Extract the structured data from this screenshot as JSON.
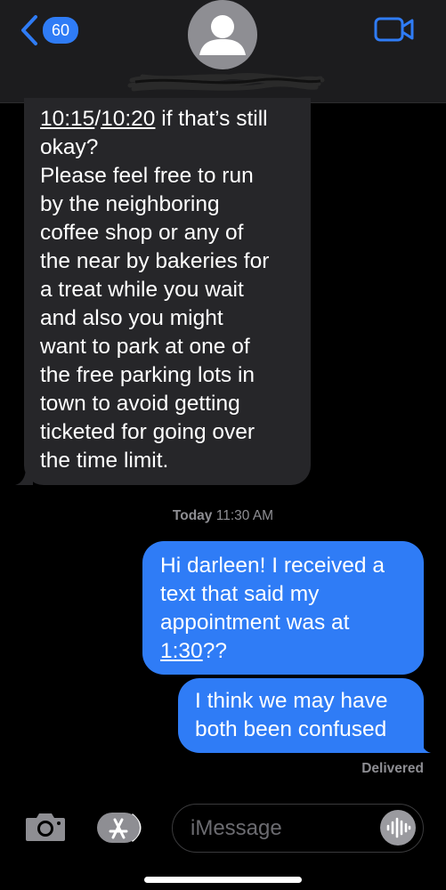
{
  "header": {
    "back_count": "60",
    "accent_color": "#2f7cf6"
  },
  "conversation": {
    "incoming_message": {
      "times_line": [
        "10:15",
        "/",
        "10:20",
        " if that’s still"
      ],
      "body": "okay?\nPlease feel free to run\nby the neighboring\ncoffee shop or any of\nthe near by bakeries for\na treat while you wait\nand also you might\nwant to park at one of\nthe free parking lots in\ntown to avoid getting\nticketed for going over\nthe time limit."
    },
    "timestamp": {
      "day": "Today",
      "time": "11:30 AM"
    },
    "outgoing_messages": [
      {
        "text": "Hi darleen! I received a\ntext that said my\nappointment was at\n",
        "link": "1:30",
        "suffix": "??"
      },
      {
        "text": "I think we may have\nboth been confused"
      }
    ],
    "status": "Delivered"
  },
  "input_bar": {
    "placeholder": "iMessage"
  }
}
